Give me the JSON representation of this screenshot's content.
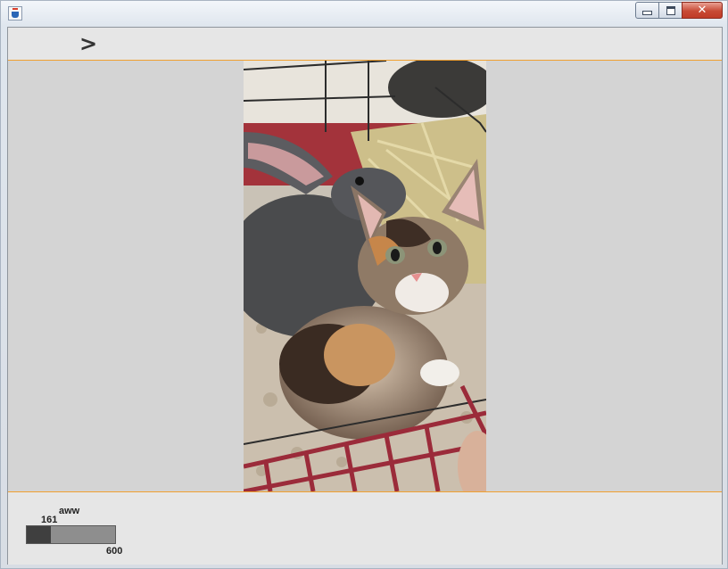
{
  "window": {
    "title": "",
    "icon": "java-cup-icon",
    "controls": [
      "minimize-icon",
      "maximize-icon",
      "close-icon"
    ]
  },
  "toolbar": {
    "next_label": ">"
  },
  "viewer": {
    "image_description_icon": "photo-kitten-and-rabbit"
  },
  "status": {
    "subreddit": "aww",
    "current": "161",
    "total": "600",
    "progress_fraction": 0.268
  },
  "colors": {
    "accent_line": "#f0a030",
    "progress_fill": "#3f3f3f",
    "progress_track": "#8e8e8e"
  }
}
